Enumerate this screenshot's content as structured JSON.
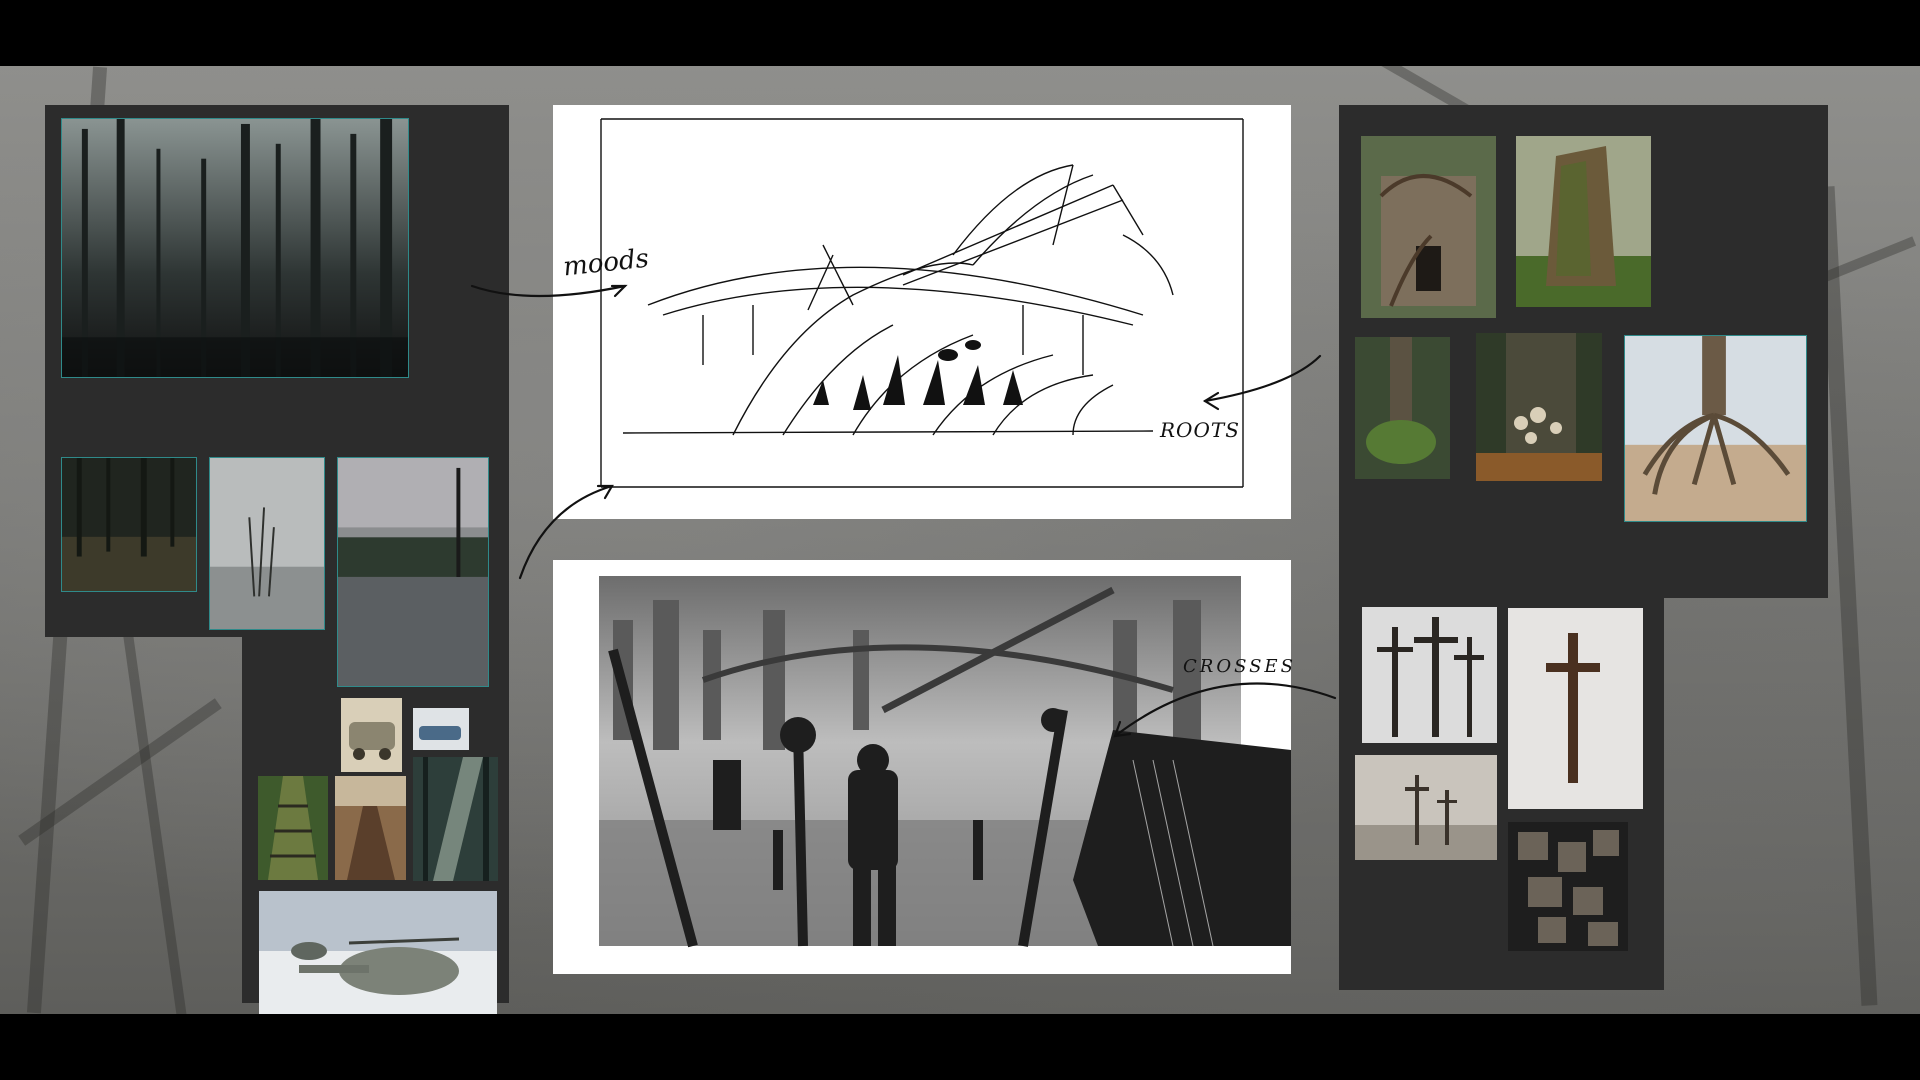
{
  "annotations": {
    "moods": "moods",
    "roots": "ROOTS",
    "crosses": "CROSSES"
  },
  "colors": {
    "background": "#7f7f7c",
    "panel": "#2c2c2c",
    "frame_accent": "#2f8a8a",
    "sheet": "#ffffff"
  }
}
